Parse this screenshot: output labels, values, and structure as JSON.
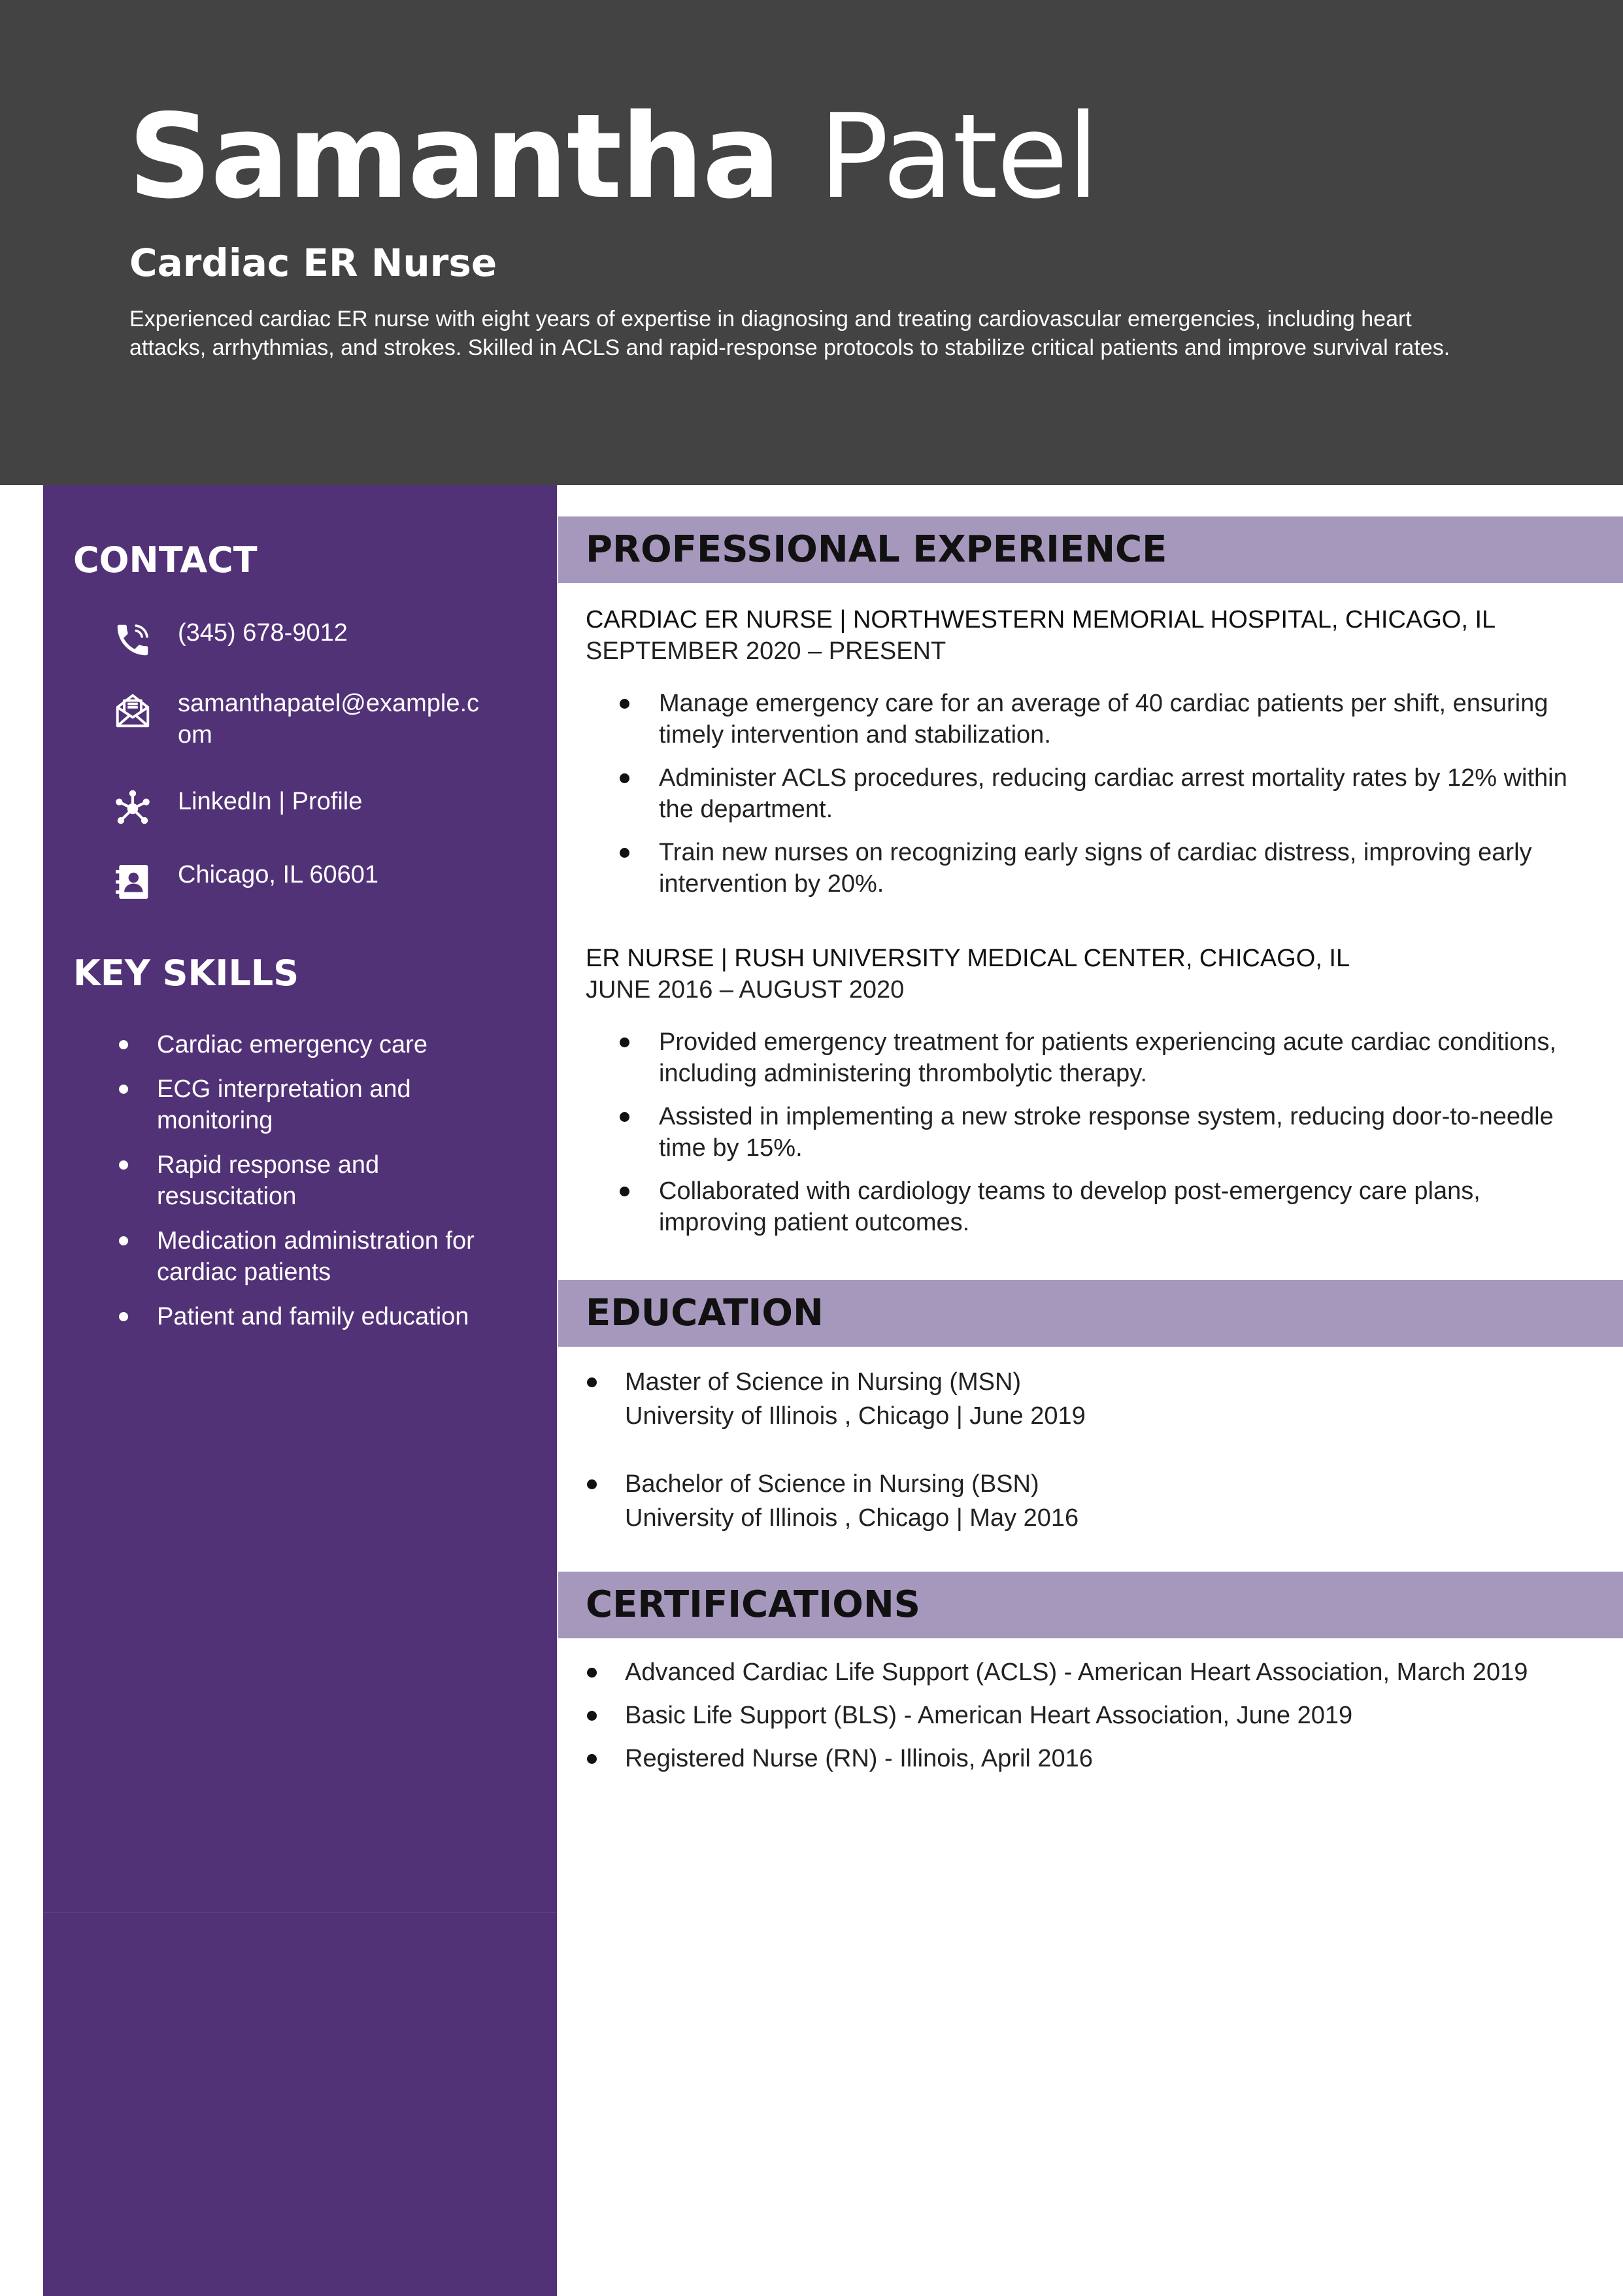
{
  "header": {
    "first_name": "Samantha",
    "last_name": "Patel",
    "job_title": "Cardiac ER Nurse",
    "summary": "Experienced cardiac ER nurse with eight years of expertise in diagnosing and treating cardiovascular emergencies, including heart attacks, arrhythmias, and strokes. Skilled in ACLS and rapid-response protocols to stabilize critical patients and improve survival rates."
  },
  "contact": {
    "heading": "CONTACT",
    "phone": "(345) 678-9012",
    "email": "samanthapatel@example.com",
    "linkedin": "LinkedIn | Profile",
    "location": "Chicago, IL 60601",
    "icons": [
      "phone-icon",
      "envelope-icon",
      "network-icon",
      "contact-card-icon"
    ]
  },
  "skills": {
    "heading": "KEY SKILLS",
    "items": [
      "Cardiac emergency care",
      "ECG interpretation and monitoring",
      "Rapid response and resuscitation",
      "Medication administration for cardiac patients",
      "Patient and family education"
    ]
  },
  "experience": {
    "heading": "PROFESSIONAL EXPERIENCE",
    "jobs": [
      {
        "title": "CARDIAC ER NURSE",
        "employer": "NORTHWESTERN MEMORIAL HOSPITAL, CHICAGO, IL",
        "dates": "SEPTEMBER 2020 – PRESENT",
        "bullets": [
          "Manage emergency care for an average of 40 cardiac patients per shift, ensuring timely intervention and stabilization.",
          "Administer ACLS procedures, reducing cardiac arrest mortality rates by 12% within the department.",
          "Train new nurses on recognizing early signs of cardiac distress, improving early intervention by 20%."
        ]
      },
      {
        "title": "ER NURSE",
        "employer": "RUSH UNIVERSITY MEDICAL CENTER, CHICAGO, IL",
        "dates": "JUNE 2016 – AUGUST 2020",
        "bullets": [
          "Provided emergency treatment for patients experiencing acute cardiac conditions, including administering thrombolytic therapy.",
          "Assisted in implementing a new stroke response system, reducing door-to-needle time by 15%.",
          "Collaborated with cardiology teams to develop post-emergency care plans, improving patient outcomes."
        ]
      }
    ]
  },
  "education": {
    "heading": "EDUCATION",
    "items": [
      {
        "degree": "Master of Science in Nursing (MSN)",
        "school": "University of Illinois , Chicago  | June 2019"
      },
      {
        "degree": "Bachelor of Science in Nursing (BSN)",
        "school": "University of Illinois , Chicago  | May 2016"
      }
    ]
  },
  "certifications": {
    "heading": "CERTIFICATIONS",
    "items": [
      "Advanced Cardiac Life Support (ACLS) - American Heart Association, March 2019",
      "Basic Life Support (BLS) - American Heart Association, June 2019",
      "Registered Nurse (RN) - Illinois, April 2016"
    ]
  },
  "colors": {
    "header_bg": "#434343",
    "sidebar_bg": "#523277",
    "section_bar": "#a698bd",
    "text_light": "#ffffff",
    "text_dark": "#111111"
  }
}
